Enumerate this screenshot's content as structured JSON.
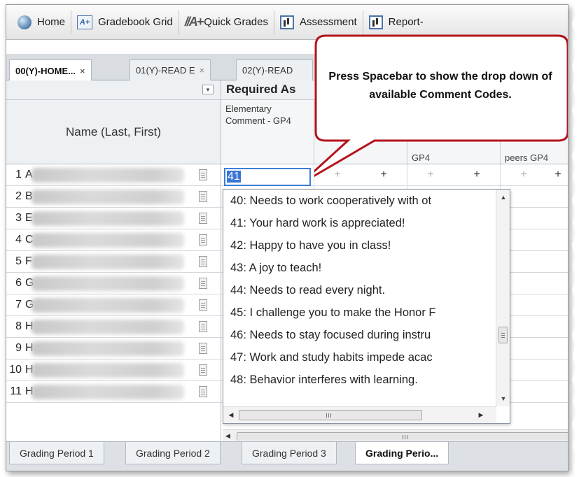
{
  "nav": {
    "items": [
      {
        "label": "Home",
        "icon": "globe-icon"
      },
      {
        "label": "Gradebook Grid",
        "icon": "gradebook-icon"
      },
      {
        "label": "Quick Grades",
        "icon": "quick-grades-icon"
      },
      {
        "label": "Assessment",
        "icon": "chart-icon"
      },
      {
        "label": "Report-",
        "icon": "chart-icon"
      }
    ]
  },
  "class_tabs": [
    {
      "label": "00(Y)-HOME...",
      "close": "×",
      "active": true
    },
    {
      "label": "01(Y)-READ E",
      "close": "×",
      "active": false
    },
    {
      "label": "02(Y)-READ",
      "close": "",
      "active": false
    }
  ],
  "grid": {
    "name_header": "Name (Last, First)",
    "group_header": "Required As",
    "columns": [
      {
        "title": "Elementary Comment - GP4",
        "sub": ""
      },
      {
        "title": "",
        "sub": ""
      },
      {
        "title": "",
        "sub": "GP4"
      },
      {
        "title": "",
        "sub": "peers GP4"
      }
    ],
    "rows": [
      {
        "num": "1",
        "initial": "A"
      },
      {
        "num": "2",
        "initial": "B"
      },
      {
        "num": "3",
        "initial": "E"
      },
      {
        "num": "4",
        "initial": "C"
      },
      {
        "num": "5",
        "initial": "F"
      },
      {
        "num": "6",
        "initial": "G"
      },
      {
        "num": "7",
        "initial": "G"
      },
      {
        "num": "8",
        "initial": "H"
      },
      {
        "num": "9",
        "initial": "H"
      },
      {
        "num": "10",
        "initial": "H"
      },
      {
        "num": "11",
        "initial": "H"
      }
    ],
    "active_cell_value": "41",
    "plus_symbol": "+"
  },
  "dropdown": {
    "items": [
      "40: Needs to work cooperatively with ot",
      "41: Your hard work is appreciated!",
      "42: Happy to have you in class!",
      "43: A joy to teach!",
      "44: Needs to read every night.",
      "45: I challenge you to make the Honor F",
      "46: Needs to stay focused during instru",
      "47: Work and study habits impede acac",
      "48: Behavior interferes with learning."
    ],
    "hscroll_grip": "III"
  },
  "grid_scroll_grip": "III",
  "callout": {
    "text": "Press Spacebar to show the drop down of available Comment Codes."
  },
  "period_tabs": [
    {
      "label": "Grading Period 1",
      "active": false
    },
    {
      "label": "Grading Period 2",
      "active": false
    },
    {
      "label": "Grading Period 3",
      "active": false
    },
    {
      "label": "Grading Perio...",
      "active": true
    }
  ],
  "colors": {
    "accent_blue": "#3875d7",
    "callout_border": "#b3151a"
  }
}
